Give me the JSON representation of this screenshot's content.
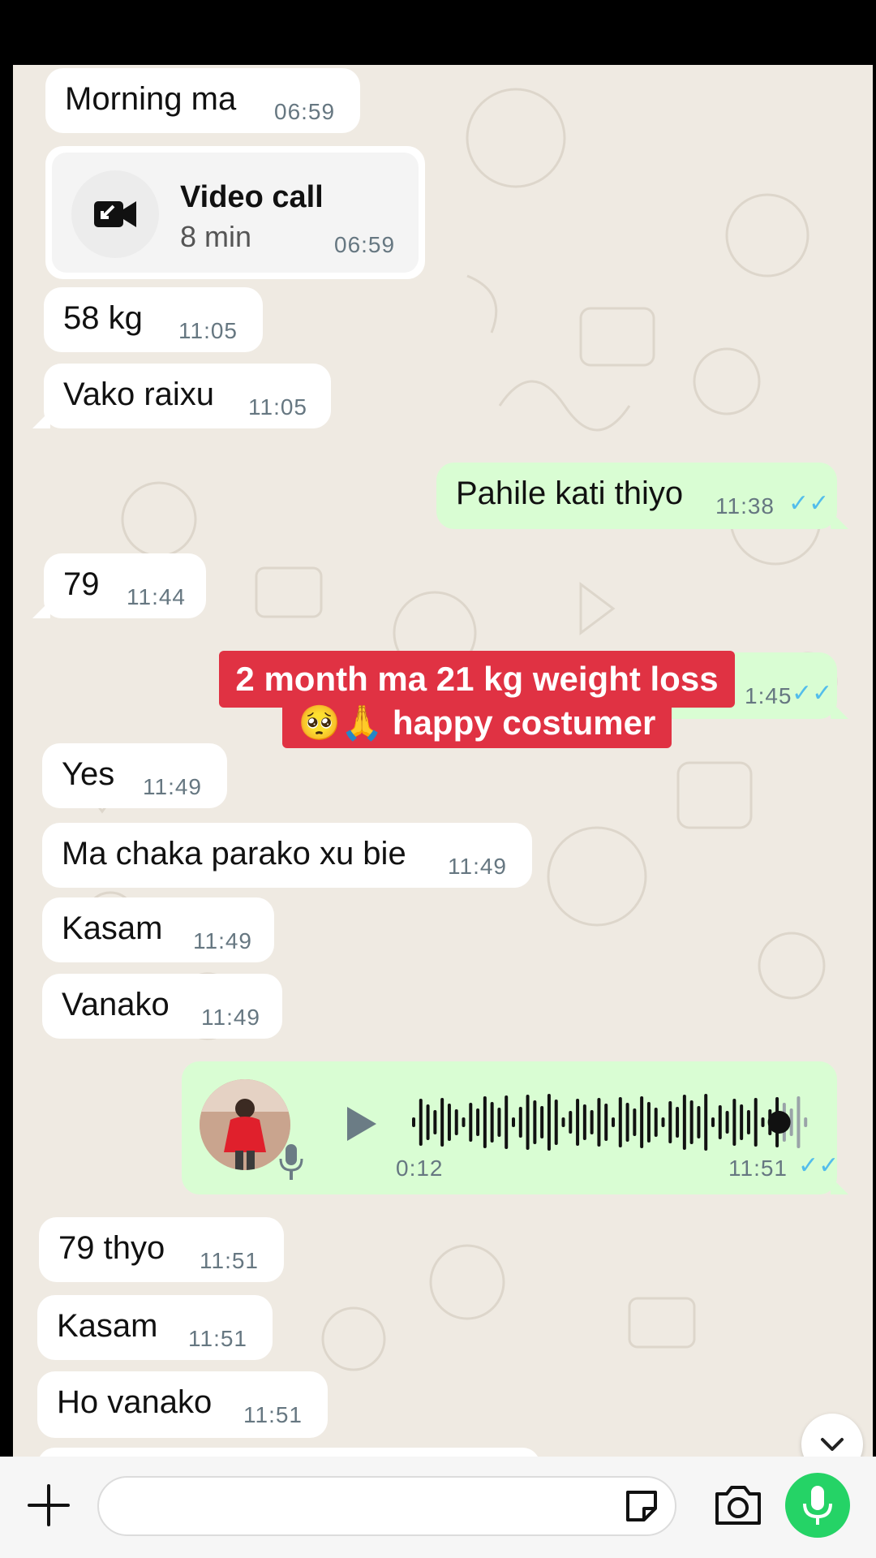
{
  "messages": {
    "m1": {
      "text": "Morning ma",
      "time": "06:59"
    },
    "call": {
      "title": "Video call",
      "duration": "8 min",
      "time": "06:59",
      "icon": "video-call-icon"
    },
    "m2": {
      "text": "58 kg",
      "time": "11:05"
    },
    "m3": {
      "text": "Vako raixu",
      "time": "11:05"
    },
    "m4": {
      "text": "Pahile kati thiyo",
      "time": "11:38",
      "status": "read"
    },
    "m5": {
      "text": "79",
      "time": "11:44"
    },
    "m6": {
      "time": "1:45",
      "status": "read"
    },
    "m7": {
      "text": "Yes",
      "time": "11:49"
    },
    "m8": {
      "text": "Ma chaka parako xu bie",
      "time": "11:49"
    },
    "m9": {
      "text": "Kasam",
      "time": "11:49"
    },
    "m10": {
      "text": "Vanako",
      "time": "11:49"
    },
    "voice": {
      "duration": "0:12",
      "time": "11:51",
      "status": "read",
      "play_icon": "play-icon",
      "mic_icon": "mic-icon",
      "progress": 0.92
    },
    "m11": {
      "text": "79 thyo",
      "time": "11:51"
    },
    "m12": {
      "text": "Kasam",
      "time": "11:51"
    },
    "m13": {
      "text": "Ho vanako",
      "time": "11:51"
    }
  },
  "overlay": {
    "line1": "2 month ma 21 kg weight loss",
    "line2": "🥺🙏 happy costumer"
  },
  "ticks_glyph": "✓✓",
  "composer": {
    "plus_icon": "plus-icon",
    "sticker_icon": "sticker-icon",
    "camera_icon": "camera-icon",
    "mic_icon": "mic-icon"
  },
  "colors": {
    "incoming": "#ffffff",
    "outgoing": "#d9fdd3",
    "wallpaper": "#efeae2",
    "read_ticks": "#53bdeb",
    "accent": "#25d366",
    "banner": "#e03243"
  }
}
